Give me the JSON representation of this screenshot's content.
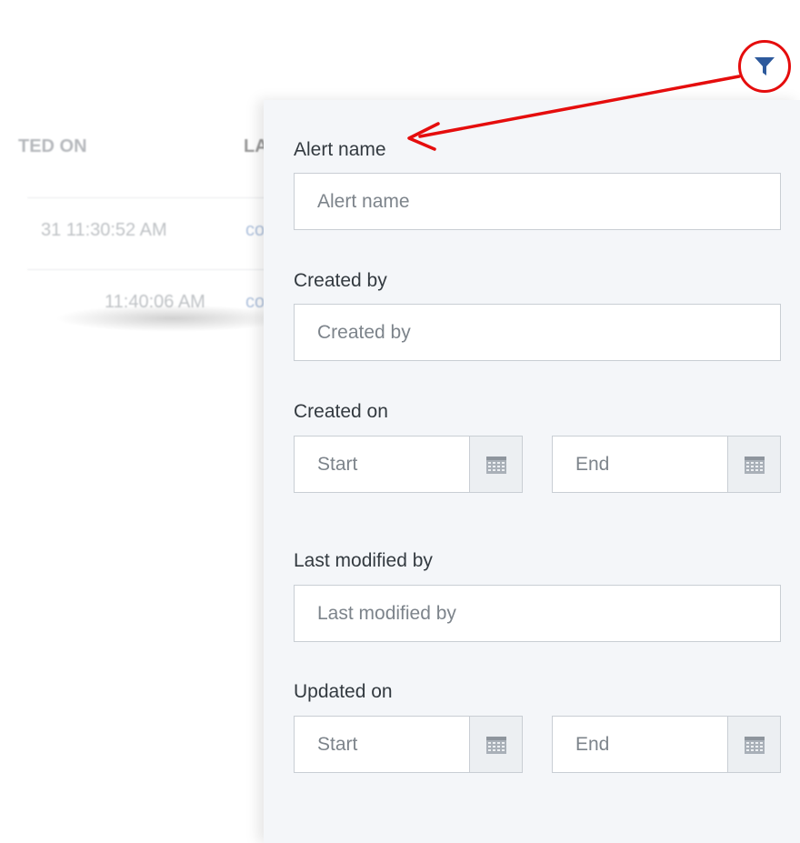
{
  "background_table": {
    "headers": [
      "TED ON",
      "LA"
    ],
    "rows": [
      {
        "date": "31 11:30:52 AM",
        "link": "co"
      },
      {
        "date": "11:40:06 AM",
        "link": "co"
      }
    ]
  },
  "filter_panel": {
    "alert_name": {
      "label": "Alert name",
      "placeholder": "Alert name",
      "value": ""
    },
    "created_by": {
      "label": "Created by",
      "placeholder": "Created by",
      "value": ""
    },
    "created_on": {
      "label": "Created on",
      "start_placeholder": "Start",
      "end_placeholder": "End"
    },
    "last_modified_by": {
      "label": "Last modified by",
      "placeholder": "Last modified by",
      "value": ""
    },
    "updated_on": {
      "label": "Updated on",
      "start_placeholder": "Start",
      "end_placeholder": "End"
    }
  },
  "icons": {
    "filter": "filter-icon",
    "calendar": "calendar-icon"
  },
  "colors": {
    "annotation_red": "#e50d0d",
    "filter_icon_blue": "#2e5a9c",
    "panel_background": "#f4f6f9"
  }
}
